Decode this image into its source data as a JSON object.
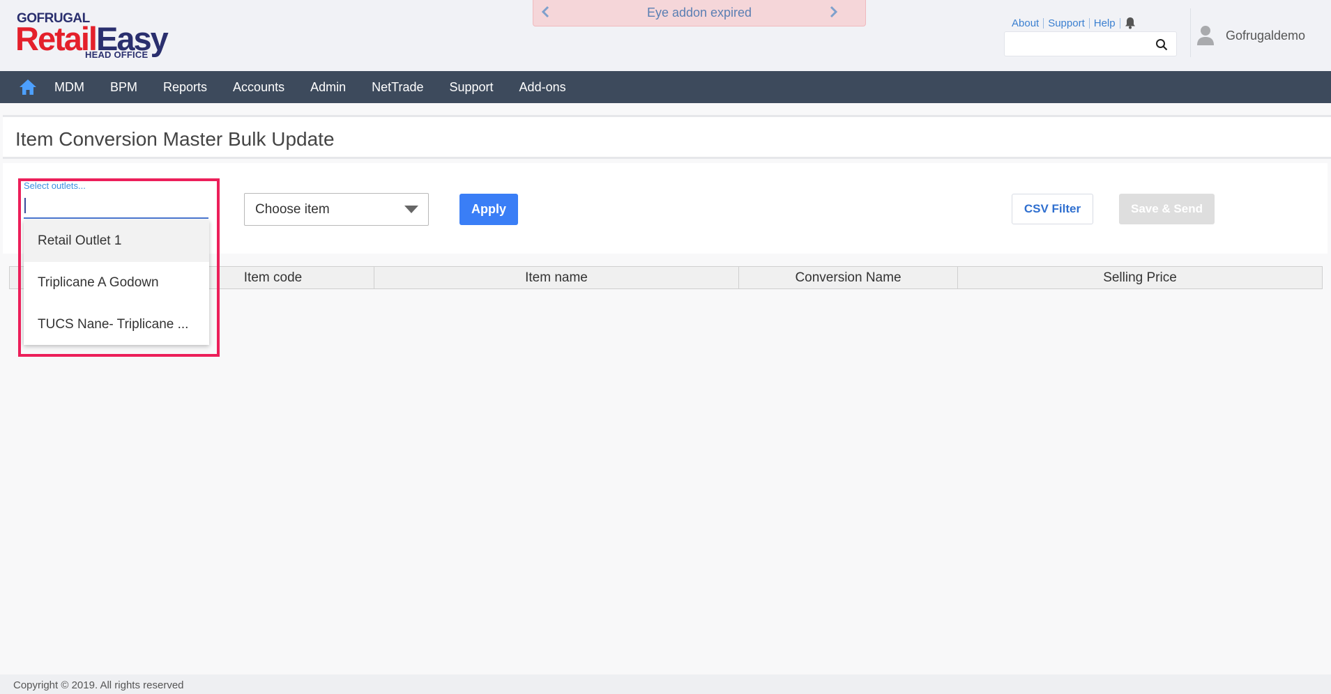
{
  "brand": {
    "top": "GOFRUGAL",
    "main_red": "Retail",
    "main_blue": "Easy",
    "sub": "HEAD OFFICE"
  },
  "notice": {
    "text": "Eye addon expired"
  },
  "top_links": {
    "about": "About",
    "support": "Support",
    "help": "Help"
  },
  "search": {
    "placeholder": ""
  },
  "user": {
    "name": "Gofrugaldemo"
  },
  "nav": {
    "items": [
      "MDM",
      "BPM",
      "Reports",
      "Accounts",
      "Admin",
      "NetTrade",
      "Support",
      "Add-ons"
    ]
  },
  "page": {
    "title": "Item Conversion Master Bulk Update"
  },
  "filters": {
    "outlets_label": "Select outlets...",
    "outlet_options": [
      "Retail Outlet 1",
      "Triplicane A Godown",
      "TUCS Nane- Triplicane ..."
    ],
    "choose_item": "Choose item",
    "apply": "Apply",
    "csv_filter": "CSV Filter",
    "save_send": "Save & Send"
  },
  "table": {
    "columns": [
      "",
      "Item code",
      "Item name",
      "Conversion Name",
      "Selling Price"
    ]
  },
  "footer": {
    "copyright": "Copyright © 2019. All rights reserved"
  },
  "colors": {
    "nav_bg": "#3d4a5c",
    "accent": "#3a7ef6",
    "brand_red": "#e4202b",
    "brand_blue": "#2a2f6e",
    "highlight": "#ec1f5a"
  }
}
